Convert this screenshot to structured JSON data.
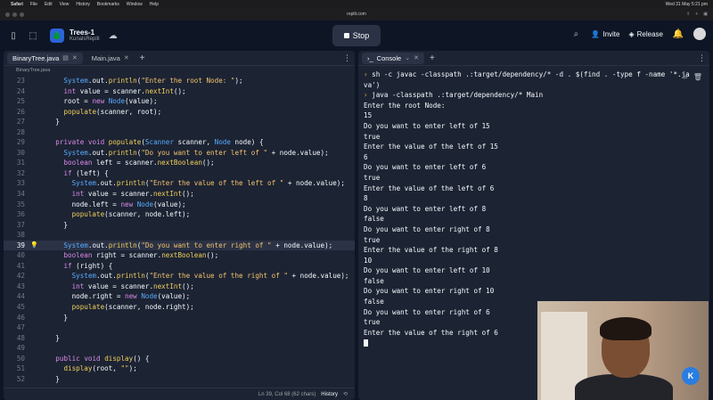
{
  "menubar": {
    "apple_icon": "apple-icon",
    "items": [
      "Safari",
      "File",
      "Edit",
      "View",
      "History",
      "Bookmarks",
      "Window",
      "Help"
    ],
    "clock": "Wed 31 May 5:21 pm"
  },
  "browser": {
    "url": "replit.com"
  },
  "header": {
    "repl_name": "Trees-1",
    "repl_owner": "KunalsReplit",
    "stop_label": "Stop",
    "invite_label": "Invite",
    "release_label": "Release"
  },
  "editor": {
    "tabs": [
      {
        "label": "BinaryTree.java",
        "active": true
      },
      {
        "label": "Main.java",
        "active": false
      }
    ],
    "breadcrumb": "BinaryTree.java",
    "lines": [
      {
        "n": "23",
        "code": "      System.out.println(\"Enter the root Node: \");"
      },
      {
        "n": "24",
        "code": "      int value = scanner.nextInt();"
      },
      {
        "n": "25",
        "code": "      root = new Node(value);"
      },
      {
        "n": "26",
        "code": "      populate(scanner, root);"
      },
      {
        "n": "27",
        "code": "    }"
      },
      {
        "n": "28",
        "code": ""
      },
      {
        "n": "29",
        "code": "    private void populate(Scanner scanner, Node node) {"
      },
      {
        "n": "30",
        "code": "      System.out.println(\"Do you want to enter left of \" + node.value);"
      },
      {
        "n": "31",
        "code": "      boolean left = scanner.nextBoolean();"
      },
      {
        "n": "32",
        "code": "      if (left) {"
      },
      {
        "n": "33",
        "code": "        System.out.println(\"Enter the value of the left of \" + node.value);"
      },
      {
        "n": "34",
        "code": "        int value = scanner.nextInt();"
      },
      {
        "n": "35",
        "code": "        node.left = new Node(value);"
      },
      {
        "n": "36",
        "code": "        populate(scanner, node.left);"
      },
      {
        "n": "37",
        "code": "      }"
      },
      {
        "n": "38",
        "code": ""
      },
      {
        "n": "39",
        "code": "      System.out.println(\"Do you want to enter right of \" + node.value);"
      },
      {
        "n": "40",
        "code": "      boolean right = scanner.nextBoolean();"
      },
      {
        "n": "41",
        "code": "      if (right) {"
      },
      {
        "n": "42",
        "code": "        System.out.println(\"Enter the value of the right of \" + node.value);"
      },
      {
        "n": "43",
        "code": "        int value = scanner.nextInt();"
      },
      {
        "n": "44",
        "code": "        node.right = new Node(value);"
      },
      {
        "n": "45",
        "code": "        populate(scanner, node.right);"
      },
      {
        "n": "46",
        "code": "      }"
      },
      {
        "n": "47",
        "code": ""
      },
      {
        "n": "48",
        "code": "    }"
      },
      {
        "n": "49",
        "code": ""
      },
      {
        "n": "50",
        "code": "    public void display() {"
      },
      {
        "n": "51",
        "code": "      display(root, \"\");"
      },
      {
        "n": "52",
        "code": "    }"
      }
    ],
    "current_line": "39",
    "status": "Ln 39, Col 68 (62 chars)",
    "history_label": "History"
  },
  "console": {
    "tab_label": "Console",
    "commands": [
      "sh -c javac -classpath .:target/dependency/* -d . $(find . -type f -name '*.java')",
      "java -classpath .:target/dependency/* Main"
    ],
    "output": [
      "Enter the root Node:",
      "15",
      "Do you want to enter left of 15",
      "true",
      "Enter the value of the left of 15",
      "6",
      "Do you want to enter left of 6",
      "true",
      "Enter the value of the left of 6",
      "8",
      "Do you want to enter left of 8",
      "false",
      "Do you want to enter right of 8",
      "true",
      "Enter the value of the right of 8",
      "10",
      "Do you want to enter left of 10",
      "false",
      "Do you want to enter right of 10",
      "false",
      "Do you want to enter right of 6",
      "true",
      "Enter the value of the right of 6"
    ]
  },
  "webcam": {
    "badge": "K"
  }
}
